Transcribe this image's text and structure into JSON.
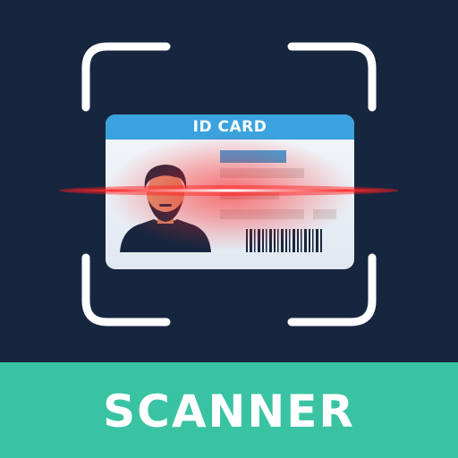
{
  "card": {
    "title": "ID CARD"
  },
  "footer": {
    "label": "SCANNER"
  },
  "colors": {
    "background": "#17263f",
    "footer": "#3ac3a2",
    "card_header": "#3aa3de",
    "scan_line": "#ff1a1a",
    "frame": "#ffffff",
    "avatar": "#17263f",
    "skin": "#d79a78"
  },
  "icons": {
    "frame": "scan-frame-icon",
    "avatar": "person-avatar-icon",
    "barcode": "barcode-icon"
  }
}
